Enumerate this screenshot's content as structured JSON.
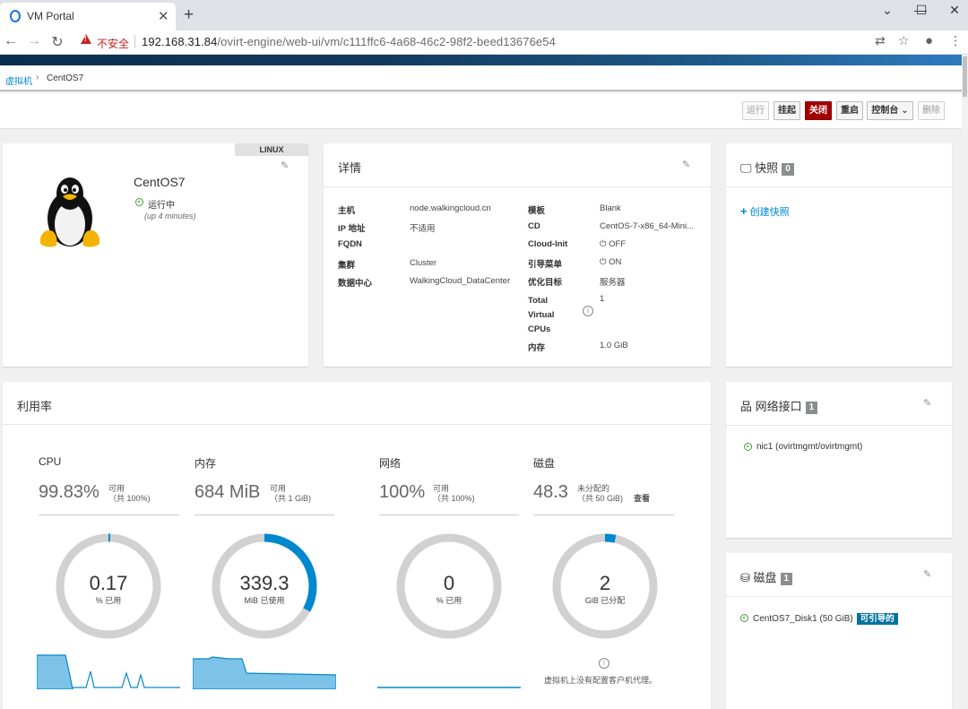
{
  "browser": {
    "tab_title": "VM Portal",
    "insecure_label": "不安全",
    "url_host": "192.168.31.84",
    "url_path": "/ovirt-engine/web-ui/vm/c111ffc6-4a68-46c2-98f2-beed13676e54"
  },
  "breadcrumb": {
    "parent": "虚拟机",
    "current": "CentOS7"
  },
  "actions": {
    "run": "运行",
    "suspend": "挂起",
    "shutdown": "关闭",
    "reboot": "重启",
    "console": "控制台",
    "delete": "删除"
  },
  "vm": {
    "os": "LINUX",
    "name": "CentOS7",
    "status": "运行中",
    "uptime": "(up 4 minutes)"
  },
  "details": {
    "title": "详情",
    "left": [
      {
        "label": "主机",
        "value": "node.walkingcloud.cn"
      },
      {
        "label": "IP 地址",
        "value": "不适用"
      },
      {
        "label": "FQDN",
        "value": ""
      },
      {
        "label": "集群",
        "value": "Cluster"
      },
      {
        "label": "数据中心",
        "value": "WalkingCloud_DataCenter"
      }
    ],
    "right": [
      {
        "label": "模板",
        "value": "Blank"
      },
      {
        "label": "CD",
        "value": "CentOS-7-x86_64-Mini..."
      },
      {
        "label": "Cloud-Init",
        "value": "OFF"
      },
      {
        "label": "引导菜单",
        "value": "ON"
      },
      {
        "label": "优化目标",
        "value": "服务器"
      },
      {
        "label": "Total Virtual CPUs",
        "value": "1"
      },
      {
        "label": "内存",
        "value": "1.0 GiB"
      }
    ]
  },
  "snapshots": {
    "title": "快照",
    "count": "0",
    "create": "创建快照"
  },
  "utilization": {
    "title": "利用率",
    "cpu": {
      "title": "CPU",
      "big": "99.83%",
      "avail": "可用",
      "total": "（共 100%)",
      "donut_value": "0.17",
      "donut_unit": "% 已用",
      "used_fraction": 0.0017
    },
    "memory": {
      "title": "内存",
      "big": "684 MiB",
      "avail": "可用",
      "total": "（共 1 GiB)",
      "donut_value": "339.3",
      "donut_unit": "MiB 已使用",
      "used_fraction": 0.331
    },
    "network": {
      "title": "网络",
      "big": "100%",
      "avail": "可用",
      "total": "（共 100%)",
      "donut_value": "0",
      "donut_unit": "% 已用",
      "used_fraction": 0
    },
    "disk": {
      "title": "磁盘",
      "big": "48.3",
      "avail": "未分配的",
      "total": "（共 50 GiB)",
      "view": "查看",
      "donut_value": "2",
      "donut_unit": "GiB 已分配",
      "used_fraction": 0.034,
      "note": "虚拟机上没有配置客户机代理。"
    }
  },
  "nics": {
    "title": "网络接口",
    "count": "1",
    "items": [
      "nic1  (ovirtmgmt/ovirtmgmt)"
    ]
  },
  "disks": {
    "title": "磁盘",
    "count": "1",
    "items": [
      {
        "name": "CentOS7_Disk1 (50 GiB)",
        "badge": "可引导的"
      }
    ]
  },
  "colors": {
    "accent": "#0088ce",
    "danger": "#a30000",
    "ok": "#3f9c35",
    "donut_track": "#d1d1d1",
    "donut_fill": "#0088ce"
  }
}
